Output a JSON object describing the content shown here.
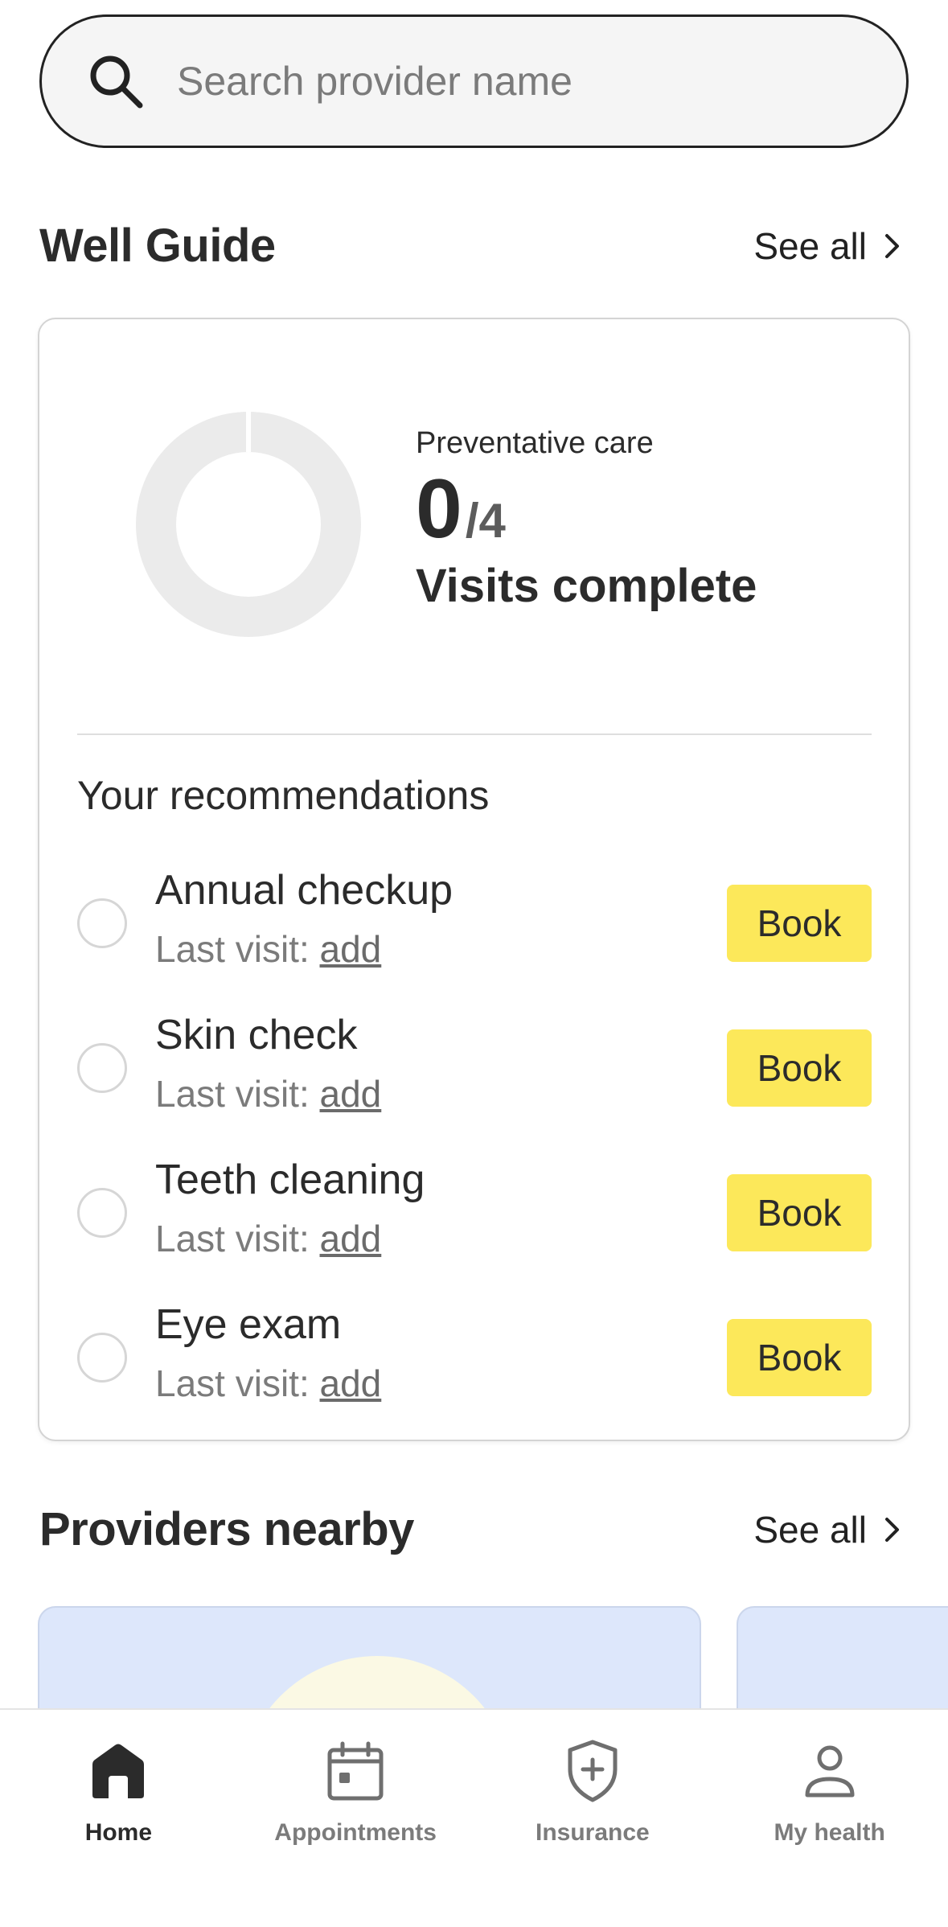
{
  "search": {
    "placeholder": "Search provider name",
    "value": ""
  },
  "well_guide": {
    "title": "Well Guide",
    "see_all": "See all",
    "care_label": "Preventative care",
    "completed": "0",
    "total": "/4",
    "visits_label": "Visits complete",
    "progress_fraction": 0
  },
  "recommendations": {
    "title": "Your recommendations",
    "items": [
      {
        "name": "Annual checkup",
        "last_visit_label": "Last visit: ",
        "add_label": "add",
        "book_label": "Book"
      },
      {
        "name": "Skin check",
        "last_visit_label": "Last visit: ",
        "add_label": "add",
        "book_label": "Book"
      },
      {
        "name": "Teeth cleaning",
        "last_visit_label": "Last visit: ",
        "add_label": "add",
        "book_label": "Book"
      },
      {
        "name": "Eye exam",
        "last_visit_label": "Last visit: ",
        "add_label": "add",
        "book_label": "Book"
      }
    ]
  },
  "providers": {
    "title": "Providers nearby",
    "see_all": "See all"
  },
  "nav": {
    "items": [
      {
        "label": "Home",
        "icon": "home-icon",
        "active": true
      },
      {
        "label": "Appointments",
        "icon": "calendar-icon",
        "active": false
      },
      {
        "label": "Insurance",
        "icon": "shield-plus-icon",
        "active": false
      },
      {
        "label": "My health",
        "icon": "person-icon",
        "active": false
      }
    ]
  },
  "colors": {
    "accent_button": "#fce85a",
    "text": "#2b2b2b",
    "muted": "#7b7b7b",
    "donut_track": "#ebebeb",
    "provider_card": "#dde7fb"
  }
}
